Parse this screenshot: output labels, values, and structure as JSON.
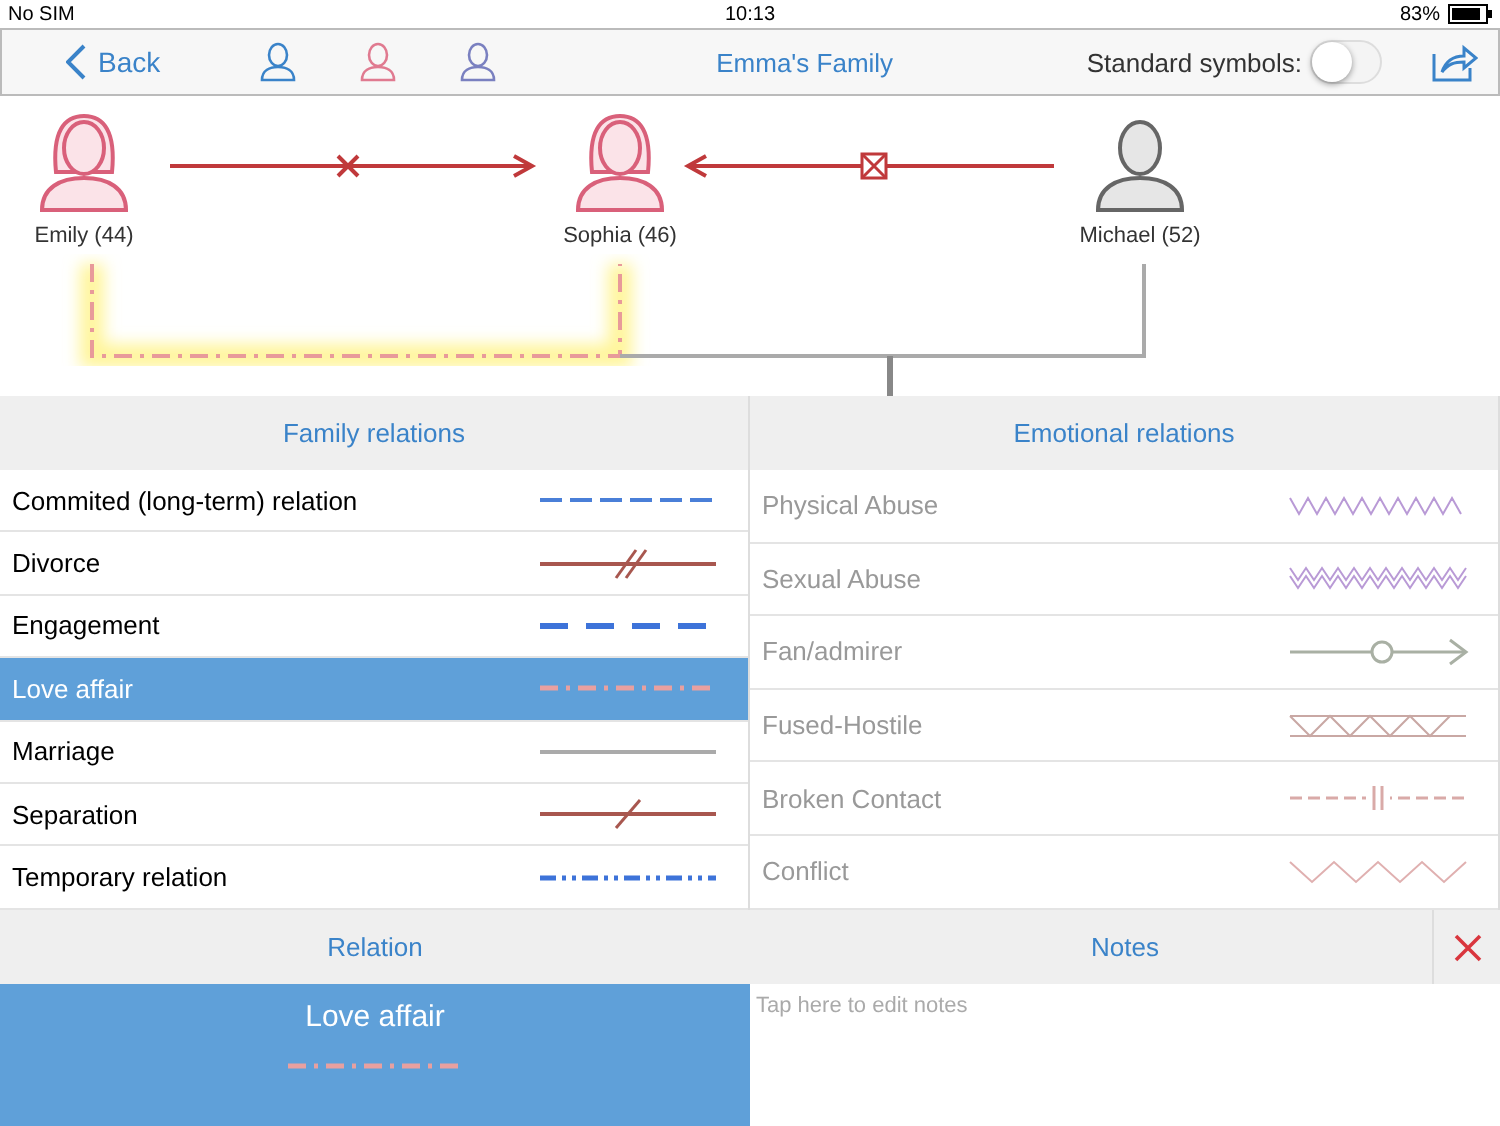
{
  "status_bar": {
    "carrier": "No SIM",
    "time": "10:13",
    "battery": "83%"
  },
  "nav": {
    "back": "Back",
    "title": "Emma's Family",
    "standard_symbols": {
      "label": "Standard symbols:",
      "on": false
    }
  },
  "people": [
    {
      "name": "Emily (44)",
      "kind": "female"
    },
    {
      "name": "Sophia (46)",
      "kind": "female"
    },
    {
      "name": "Michael (52)",
      "kind": "male"
    }
  ],
  "family_relations": {
    "title": "Family relations",
    "items": [
      {
        "label": "Commited (long-term) relation",
        "kind": "dashed",
        "color": "#4a7fd8",
        "selected": false
      },
      {
        "label": "Divorce",
        "kind": "double-slash",
        "color": "#a8574f",
        "selected": false
      },
      {
        "label": "Engagement",
        "kind": "dash",
        "color": "#3d73d9",
        "selected": false
      },
      {
        "label": "Love affair",
        "kind": "dash-dot",
        "color": "#e8a0a0",
        "selected": true
      },
      {
        "label": "Marriage",
        "kind": "solid",
        "color": "#aaaaaa",
        "selected": false
      },
      {
        "label": "Separation",
        "kind": "slash",
        "color": "#a8574f",
        "selected": false
      },
      {
        "label": "Temporary relation",
        "kind": "dash-dot-dot",
        "color": "#3d73d9",
        "selected": false
      }
    ]
  },
  "emotional_relations": {
    "title": "Emotional relations",
    "items": [
      {
        "label": "Physical Abuse",
        "kind": "zigzag",
        "color": "#b99ad6"
      },
      {
        "label": "Sexual Abuse",
        "kind": "double-zigzag",
        "color": "#b99ad6"
      },
      {
        "label": "Fan/admirer",
        "kind": "circle-arrow",
        "color": "#a9b0a4"
      },
      {
        "label": "Fused-Hostile",
        "kind": "fused-hostile",
        "color": "#c9a8a4"
      },
      {
        "label": "Broken Contact",
        "kind": "broken",
        "color": "#d9aaa8"
      },
      {
        "label": "Conflict",
        "kind": "conflict",
        "color": "#e0b0b0"
      }
    ]
  },
  "relation": {
    "title": "Relation",
    "value": "Love affair",
    "kind": "dash-dot",
    "color": "#e8a0a0"
  },
  "notes": {
    "title": "Notes",
    "placeholder": "Tap here to edit notes"
  }
}
